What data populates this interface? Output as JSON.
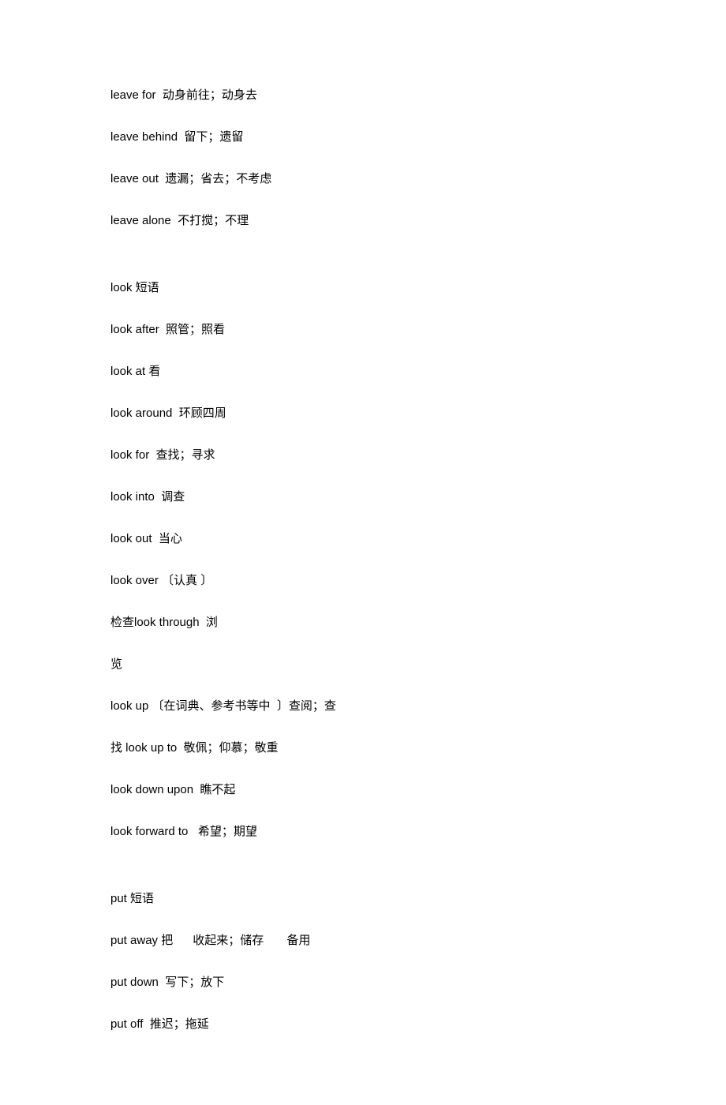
{
  "lines": [
    {
      "text": "leave for  动身前往；动身去",
      "gapAfter": false
    },
    {
      "text": "leave behind  留下；遗留",
      "gapAfter": false
    },
    {
      "text": "leave out  遗漏；省去；不考虑",
      "gapAfter": false
    },
    {
      "text": "leave alone  不打搅；不理",
      "gapAfter": true
    },
    {
      "text": "look 短语",
      "gapAfter": false
    },
    {
      "text": "look after  照管；照看",
      "gapAfter": false
    },
    {
      "text": "look at 看",
      "gapAfter": false
    },
    {
      "text": "look around  环顾四周",
      "gapAfter": false
    },
    {
      "text": "look for  查找；寻求",
      "gapAfter": false
    },
    {
      "text": "look into  调查",
      "gapAfter": false
    },
    {
      "text": "look out  当心",
      "gapAfter": false
    },
    {
      "text": "look over 〔认真 〕",
      "gapAfter": false
    },
    {
      "text": "检查look through  浏",
      "gapAfter": false
    },
    {
      "text": "览",
      "gapAfter": false
    },
    {
      "text": "look up 〔在词典、参考书等中  〕查阅；查",
      "gapAfter": false
    },
    {
      "text": "找 look up to  敬佩；仰慕；敬重",
      "gapAfter": false
    },
    {
      "text": "look down upon  瞧不起",
      "gapAfter": false
    },
    {
      "text": "look forward to   希望；期望",
      "gapAfter": true
    },
    {
      "text": "put 短语",
      "gapAfter": false
    },
    {
      "text": "put away 把      收起来；储存       备用",
      "gapAfter": false
    },
    {
      "text": "put down  写下；放下",
      "gapAfter": false
    },
    {
      "text": "put off  推迟；拖延",
      "gapAfter": false
    }
  ]
}
